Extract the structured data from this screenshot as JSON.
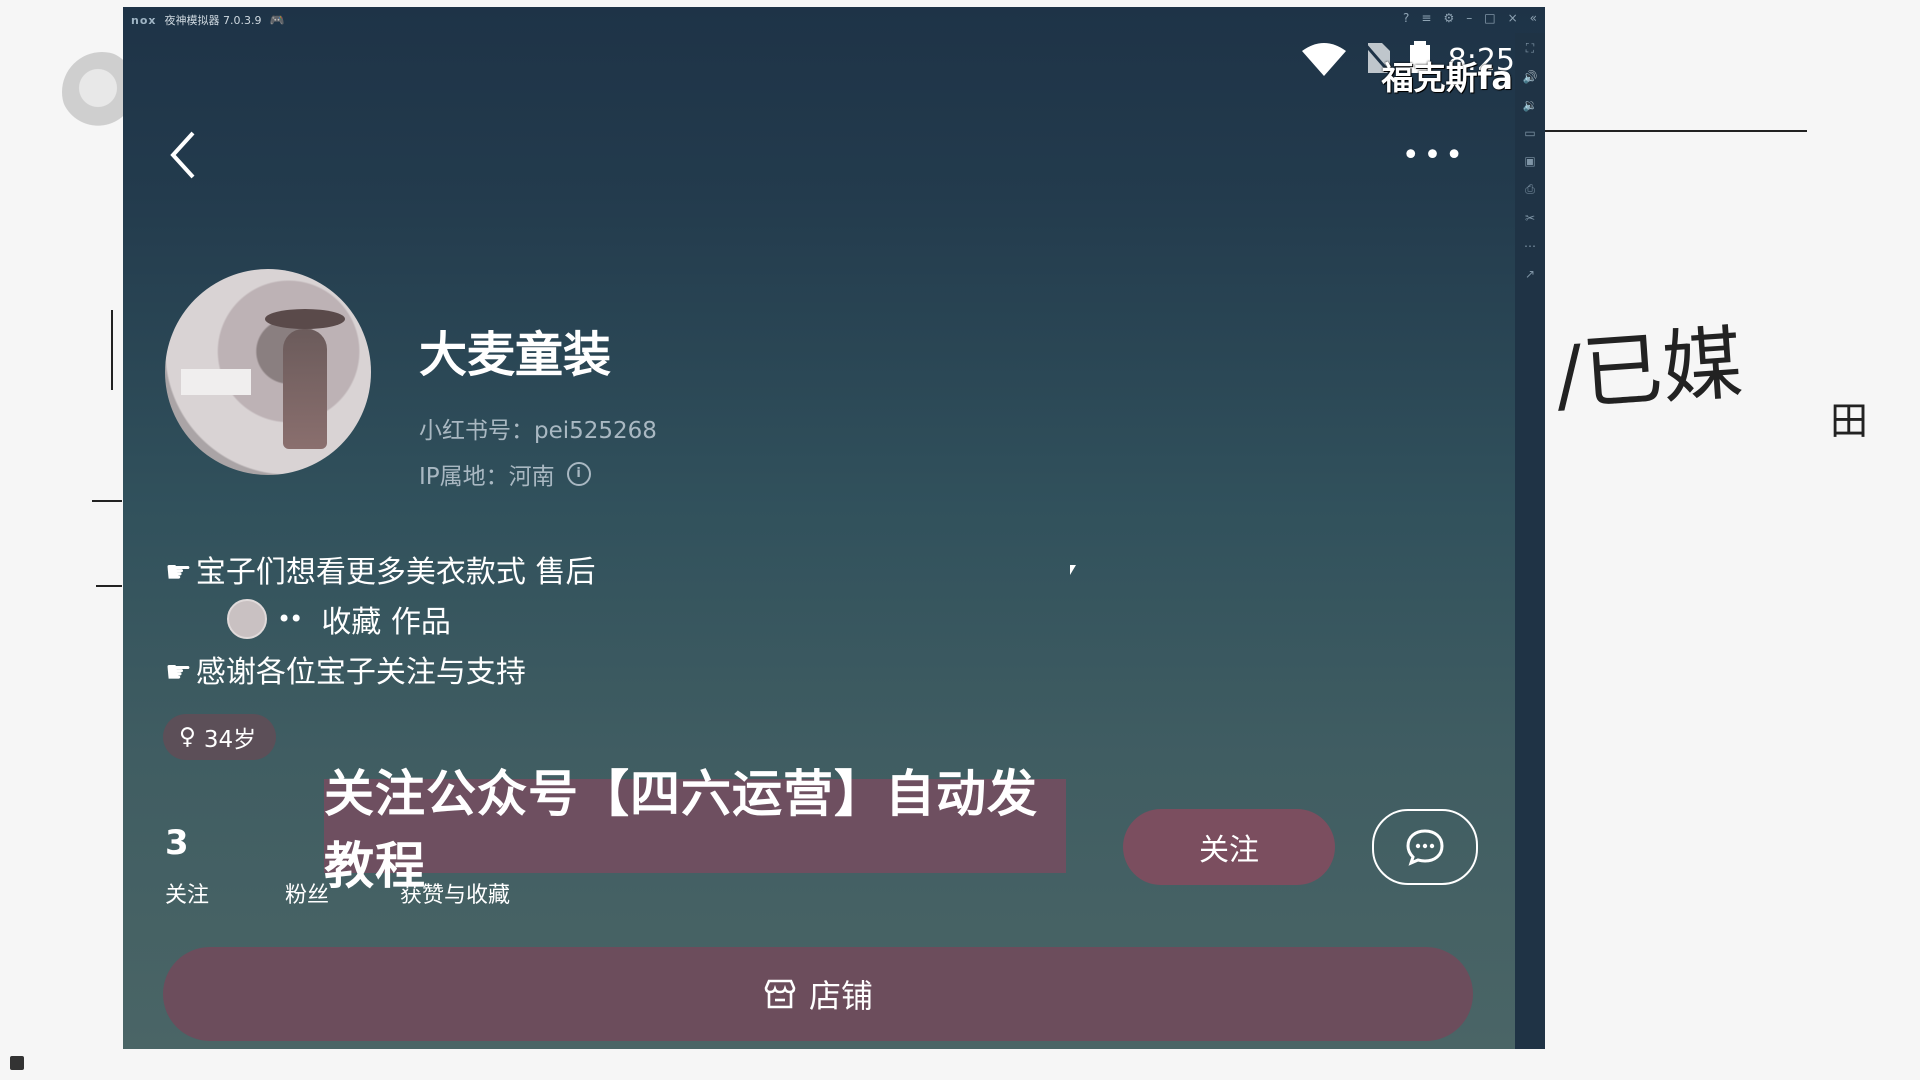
{
  "emulator": {
    "title": "夜神模拟器 7.0.3.9",
    "brand": "nox"
  },
  "status_bar": {
    "time": "8:25",
    "overlay_label": "福克斯fa"
  },
  "nav": {
    "back_icon": "chevron-left-icon",
    "more_icon": "more-dots-icon"
  },
  "profile": {
    "name": "大麦童装",
    "redbook_id": "小红书号：pei525268",
    "ip_location": "IP属地：河南",
    "bio_line1": "宝子们想看更多美衣款式 售后",
    "bio_line2": "收藏 作品",
    "bio_line3": "感谢各位宝子关注与支持",
    "age_tag": "34岁"
  },
  "stats": [
    {
      "value": "3",
      "label": "关注"
    },
    {
      "value": "",
      "label": "粉丝"
    },
    {
      "value": "",
      "label": "获赞与收藏"
    }
  ],
  "buttons": {
    "follow": "关注",
    "store": "店铺"
  },
  "overlay_banner": "关注公众号【四六运营】自动发教程",
  "colors": {
    "background_top": "#1e3347",
    "background_bottom": "#4a6566",
    "button_fill": "#7b4e5f"
  }
}
